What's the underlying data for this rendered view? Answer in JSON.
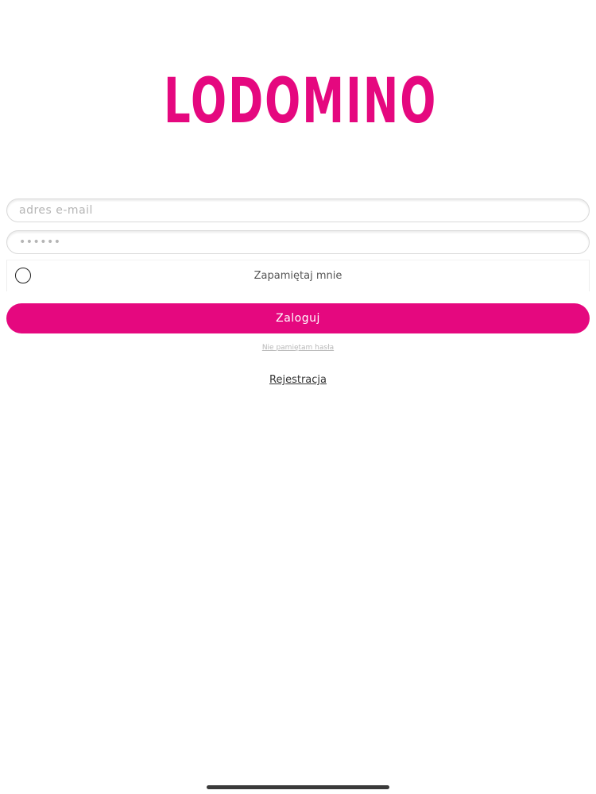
{
  "brand": {
    "name": "LODOMINO",
    "color": "#e5087f",
    "icon": "ice-cream-cone-icon"
  },
  "form": {
    "email_placeholder": "adres e-mail",
    "email_value": "",
    "password_placeholder": "••••••",
    "password_value": "",
    "remember_label": "Zapamiętaj mnie",
    "remember_checked": false,
    "login_label": "Zaloguj",
    "forgot_label": "Nie pamiętam hasła",
    "register_label": "Rejestracja"
  },
  "colors": {
    "accent": "#e5087f",
    "scoop_yellow": "#f2c21b",
    "scoop_green": "#1a9a4a"
  }
}
